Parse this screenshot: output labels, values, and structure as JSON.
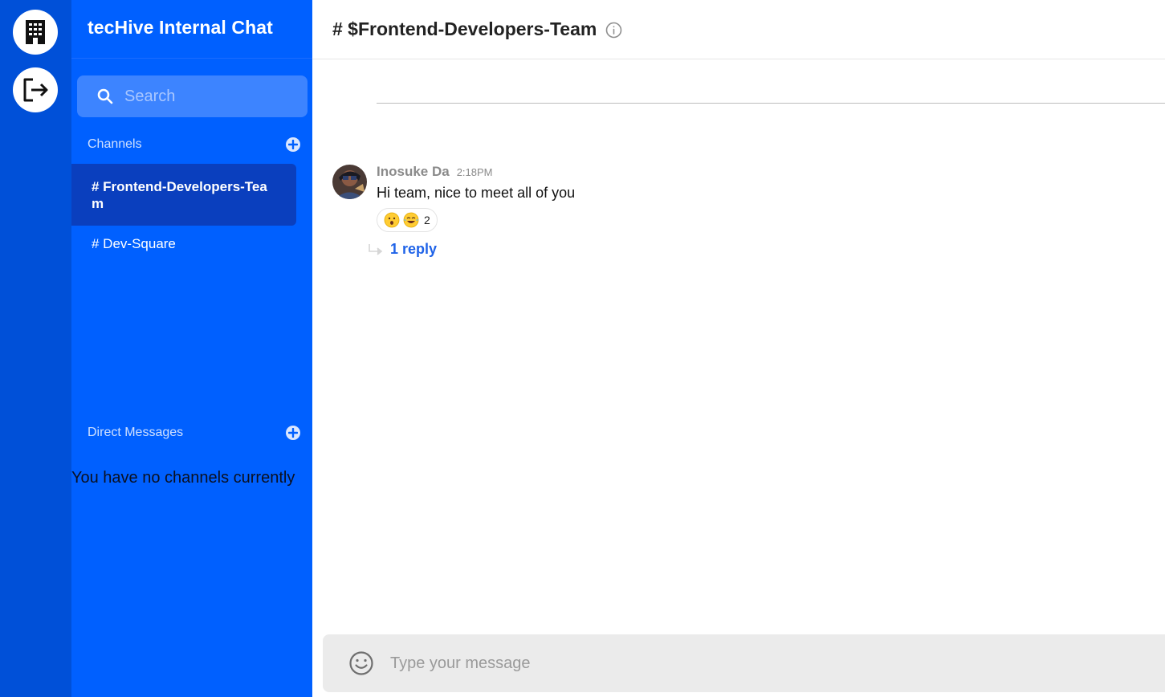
{
  "rail": {
    "workspace_icon": "building-icon",
    "logout_icon": "logout-icon"
  },
  "sidebar": {
    "app_title": "tecHive Internal Chat",
    "search_placeholder": "Search",
    "channels_label": "Channels",
    "channels": [
      {
        "label": "# Frontend-Developers-Team",
        "active": true
      },
      {
        "label": "# Dev-Square",
        "active": false
      }
    ],
    "dms_label": "Direct Messages",
    "dms_empty": "You have no channels currently"
  },
  "main": {
    "channel_title": "# $Frontend-Developers-Team",
    "messages": [
      {
        "author": "Inosuke Da",
        "time": "2:18PM",
        "text": "Hi team, nice to meet all of you",
        "reactions": [
          "hushed-face-emoji",
          "laughing-tears-emoji"
        ],
        "reaction_count": "2",
        "replies_label": "1 reply"
      }
    ],
    "composer_placeholder": "Type your message"
  },
  "colors": {
    "rail": "#0050d8",
    "sidebar": "#0060ff",
    "active_channel": "#0a3fbe",
    "link": "#1f63e8"
  }
}
